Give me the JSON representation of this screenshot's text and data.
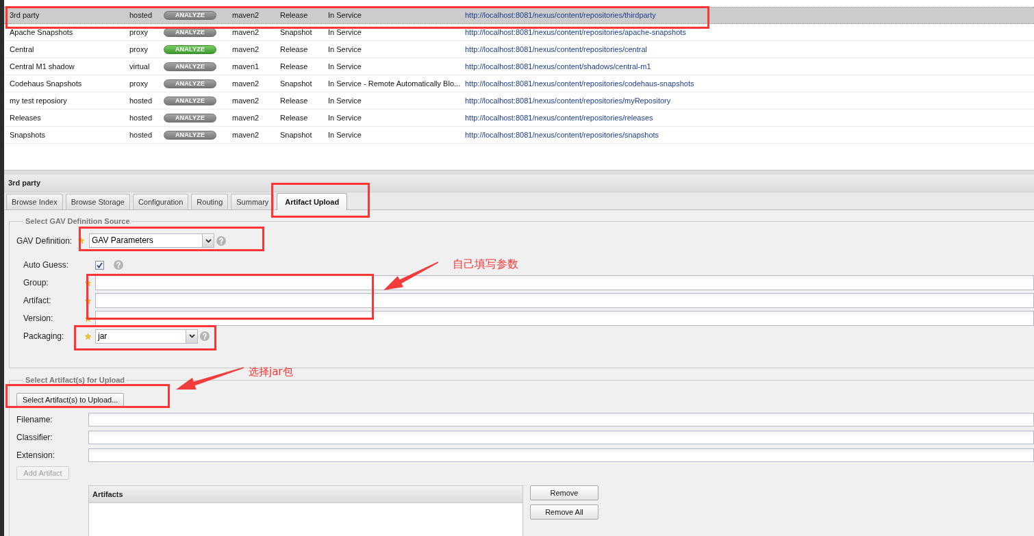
{
  "repositories": {
    "rows": [
      {
        "name": "3rd party",
        "type": "hosted",
        "analyze": {
          "label": "ANALYZE",
          "disabled": true
        },
        "format": "maven2",
        "policy": "Release",
        "status": "In Service",
        "url": "http://localhost:8081/nexus/content/repositories/thirdparty",
        "selected": true
      },
      {
        "name": "Apache Snapshots",
        "type": "proxy",
        "analyze": {
          "label": "ANALYZE",
          "disabled": true
        },
        "format": "maven2",
        "policy": "Snapshot",
        "status": "In Service",
        "url": "http://localhost:8081/nexus/content/repositories/apache-snapshots",
        "selected": false
      },
      {
        "name": "Central",
        "type": "proxy",
        "analyze": {
          "label": "ANALYZE",
          "disabled": false
        },
        "format": "maven2",
        "policy": "Release",
        "status": "In Service",
        "url": "http://localhost:8081/nexus/content/repositories/central",
        "selected": false
      },
      {
        "name": "Central M1 shadow",
        "type": "virtual",
        "analyze": {
          "label": "ANALYZE",
          "disabled": true
        },
        "format": "maven1",
        "policy": "Release",
        "status": "In Service",
        "url": "http://localhost:8081/nexus/content/shadows/central-m1",
        "selected": false
      },
      {
        "name": "Codehaus Snapshots",
        "type": "proxy",
        "analyze": {
          "label": "ANALYZE",
          "disabled": true
        },
        "format": "maven2",
        "policy": "Snapshot",
        "status": "In Service - Remote Automatically Blo...",
        "url": "http://localhost:8081/nexus/content/repositories/codehaus-snapshots",
        "selected": false
      },
      {
        "name": "my test reposiory",
        "type": "hosted",
        "analyze": {
          "label": "ANALYZE",
          "disabled": true
        },
        "format": "maven2",
        "policy": "Release",
        "status": "In Service",
        "url": "http://localhost:8081/nexus/content/repositories/myRepository",
        "selected": false
      },
      {
        "name": "Releases",
        "type": "hosted",
        "analyze": {
          "label": "ANALYZE",
          "disabled": true
        },
        "format": "maven2",
        "policy": "Release",
        "status": "In Service",
        "url": "http://localhost:8081/nexus/content/repositories/releases",
        "selected": false
      },
      {
        "name": "Snapshots",
        "type": "hosted",
        "analyze": {
          "label": "ANALYZE",
          "disabled": true
        },
        "format": "maven2",
        "policy": "Snapshot",
        "status": "In Service",
        "url": "http://localhost:8081/nexus/content/repositories/snapshots",
        "selected": false
      }
    ]
  },
  "panel": {
    "title": "3rd party",
    "tabs": [
      {
        "label": "Browse Index",
        "selected": false
      },
      {
        "label": "Browse Storage",
        "selected": false
      },
      {
        "label": "Configuration",
        "selected": false
      },
      {
        "label": "Routing",
        "selected": false
      },
      {
        "label": "Summary",
        "selected": false
      },
      {
        "label": "Artifact Upload",
        "selected": true
      }
    ]
  },
  "gav_source": {
    "legend": "Select GAV Definition Source",
    "gav_definition": {
      "label": "GAV Definition:",
      "value": "GAV Parameters",
      "required": true,
      "help": true
    },
    "parameters": [
      {
        "kind": "checkbox",
        "label": "Auto Guess:",
        "checked": true,
        "required": false,
        "help": true
      },
      {
        "kind": "text",
        "label": "Group:",
        "required": true,
        "help": false
      },
      {
        "kind": "text",
        "label": "Artifact:",
        "required": true,
        "help": false
      },
      {
        "kind": "text",
        "label": "Version:",
        "required": true,
        "help": false
      },
      {
        "kind": "combo",
        "label": "Packaging:",
        "value": "jar",
        "required": true,
        "help": true
      }
    ]
  },
  "artifact_upload": {
    "legend": "Select Artifact(s) for Upload",
    "select_button": "Select Artifact(s) to Upload...",
    "fields": [
      {
        "label": "Filename:"
      },
      {
        "label": "Classifier:"
      },
      {
        "label": "Extension:"
      }
    ],
    "add_button": {
      "label": "Add Artifact",
      "disabled": true
    },
    "artifacts_grid": {
      "title": "Artifacts"
    },
    "buttons": [
      "Remove",
      "Remove All"
    ]
  },
  "annotations": [
    {
      "text": "自己填写参数"
    },
    {
      "text": "选择jar包"
    }
  ]
}
